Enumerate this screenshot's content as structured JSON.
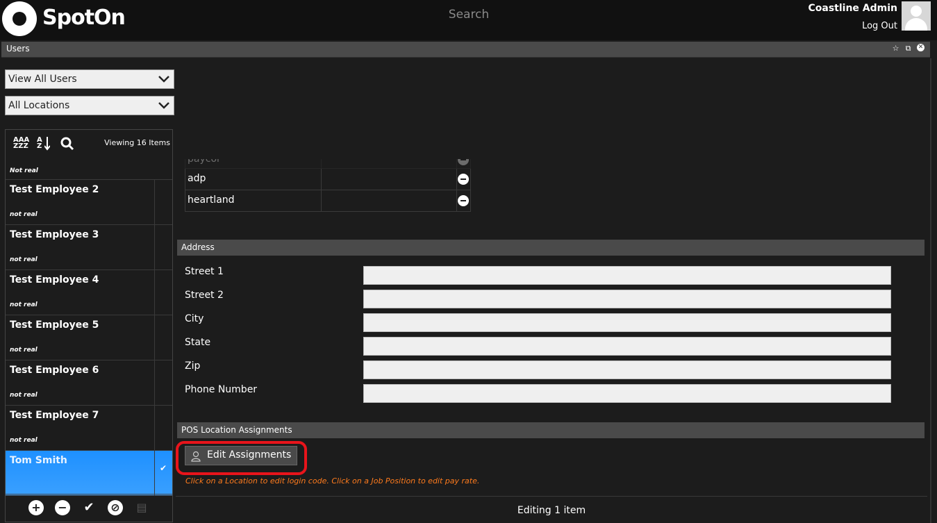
{
  "header": {
    "brand": "SpotOn",
    "search_label": "Search",
    "admin_name": "Coastline Admin",
    "logout_label": "Log Out"
  },
  "panel": {
    "title": "Users",
    "icons": [
      "star-icon",
      "restore-window-icon",
      "close-icon"
    ]
  },
  "filters": {
    "users_select": "View All Users",
    "locations_select": "All Locations"
  },
  "list": {
    "toolbar": {
      "sort_aaa_top": "AAA",
      "sort_aaa_bottom": "ZZZ",
      "sort_az_top": "A",
      "sort_az_bottom": "Z",
      "viewing": "Viewing 16 Items"
    },
    "partial_item_sub": "Not real",
    "items": [
      {
        "name": "Test Employee 2",
        "sub": "not real"
      },
      {
        "name": "Test Employee 3",
        "sub": "not real"
      },
      {
        "name": "Test Employee 4",
        "sub": "not real"
      },
      {
        "name": "Test Employee 5",
        "sub": "not real"
      },
      {
        "name": "Test Employee 6",
        "sub": "not real"
      },
      {
        "name": "Test Employee 7",
        "sub": "not real"
      },
      {
        "name": "Tom Smith",
        "sub": ""
      }
    ],
    "bottom_icons": [
      "add-icon",
      "remove-icon",
      "check-icon",
      "disable-icon",
      "clipboard-icon"
    ]
  },
  "payroll": {
    "rows": [
      {
        "name": "paycor"
      },
      {
        "name": "adp"
      },
      {
        "name": "heartland"
      }
    ]
  },
  "address": {
    "title": "Address",
    "fields": [
      {
        "label": "Street 1",
        "value": ""
      },
      {
        "label": "Street 2",
        "value": ""
      },
      {
        "label": "City",
        "value": ""
      },
      {
        "label": "State",
        "value": ""
      },
      {
        "label": "Zip",
        "value": ""
      },
      {
        "label": "Phone Number",
        "value": ""
      }
    ]
  },
  "pos": {
    "title": "POS Location Assignments",
    "edit_button": "Edit Assignments",
    "hint": "Click on a Location to edit login code.  Click on a Job Position to edit pay rate."
  },
  "footer": {
    "status": "Editing 1 item"
  },
  "colors": {
    "selected_item": "#1e90ff",
    "highlight_border": "#e8141b",
    "hint_text": "#ff7b1c"
  }
}
